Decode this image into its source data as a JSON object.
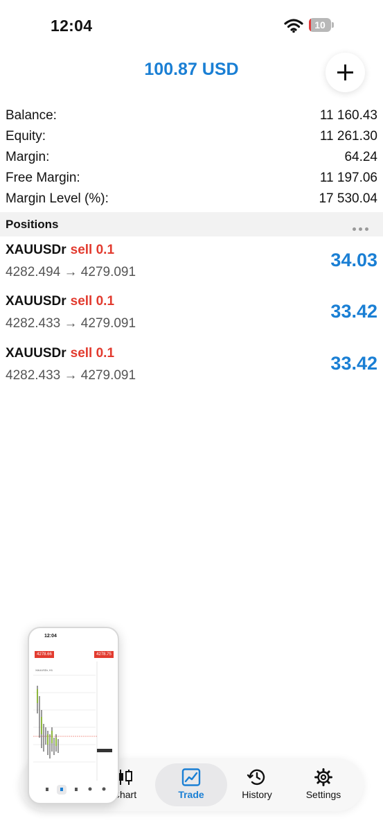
{
  "status_bar": {
    "time": "12:04",
    "battery_level": "10",
    "battery_fraction": 0.1
  },
  "header": {
    "total_profit": "100.87 USD"
  },
  "summary": [
    {
      "label": "Balance:",
      "value": "11 160.43"
    },
    {
      "label": "Equity:",
      "value": "11 261.30"
    },
    {
      "label": "Margin:",
      "value": "64.24"
    },
    {
      "label": "Free Margin:",
      "value": "11 197.06"
    },
    {
      "label": "Margin Level (%):",
      "value": "17 530.04"
    }
  ],
  "positions": {
    "title": "Positions",
    "items": [
      {
        "symbol": "XAUUSDr",
        "side": "sell 0.1",
        "prices": "4282.494 → 4279.091",
        "profit": "34.03"
      },
      {
        "symbol": "XAUUSDr",
        "side": "sell 0.1",
        "prices": "4282.433 → 4279.091",
        "profit": "33.42"
      },
      {
        "symbol": "XAUUSDr",
        "side": "sell 0.1",
        "prices": "4282.433 → 4279.091",
        "profit": "33.42"
      }
    ]
  },
  "tab_bar": {
    "tabs": [
      {
        "label": "Chart",
        "icon": "candlestick-icon"
      },
      {
        "label": "Trade",
        "icon": "trend-chart-icon",
        "active": true
      },
      {
        "label": "History",
        "icon": "history-clock-icon"
      },
      {
        "label": "Settings",
        "icon": "gear-icon"
      }
    ]
  },
  "thumbnail": {
    "time": "12:04",
    "sell_price": "4278.66",
    "buy_price": "4278.75"
  },
  "colors": {
    "accent": "#1a7fd4",
    "sell": "#e23b2f",
    "battery_low": "#e23b3b"
  }
}
